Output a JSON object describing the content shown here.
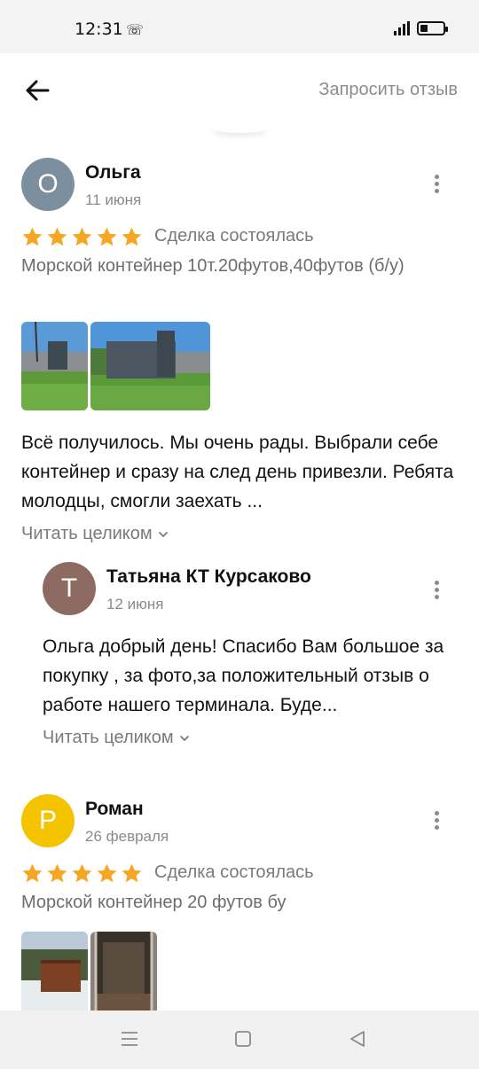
{
  "status_bar": {
    "time": "12:31"
  },
  "header": {
    "request_review": "Запросить отзыв"
  },
  "reviews": [
    {
      "avatar_letter": "О",
      "avatar_color": "#7b8f9e",
      "author": "Ольга",
      "date": "11 июня",
      "rating": 5,
      "deal_status": "Сделка состоялась",
      "item": "Морской контейнер 10т.20футов,40футов (б/у)",
      "photo_count": 2,
      "text": "Всё получилось. Мы очень рады. Выбрали себе контейнер и сразу на след день привезли. Ребята молодцы, смогли заехать ...",
      "read_more": "Читать целиком",
      "reply": {
        "avatar_letter": "Т",
        "avatar_color": "#8e6b62",
        "author": "Татьяна  КТ Курсаково",
        "date": "12 июня",
        "text": "Ольга добрый день! Спасибо Вам большое за покупку , за фото,за положительный отзыв о  работе нашего терминала. Буде...",
        "read_more": "Читать целиком"
      }
    },
    {
      "avatar_letter": "Р",
      "avatar_color": "#f5c400",
      "author": "Роман",
      "date": "26 февраля",
      "rating": 5,
      "deal_status": "Сделка состоялась",
      "item": "Морской контейнер 20 футов бу",
      "photo_count": 2
    }
  ],
  "colors": {
    "star": "#f5a623",
    "accent_gray": "#8a8a8a"
  }
}
